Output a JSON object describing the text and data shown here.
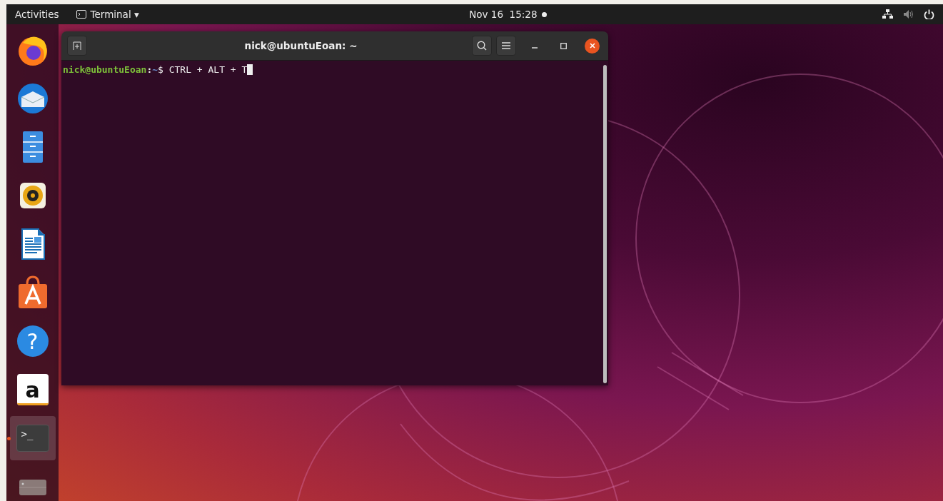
{
  "top_bar": {
    "activities": "Activities",
    "app_menu": {
      "label": "Terminal",
      "caret": "▾"
    },
    "clock": "Nov 16  15:28",
    "notification": true,
    "status_icons": [
      {
        "kind": "network"
      },
      {
        "kind": "volume"
      },
      {
        "kind": "power"
      }
    ]
  },
  "dock": [
    {
      "kind": "firefox",
      "running": false,
      "selected": false
    },
    {
      "kind": "thunderbird",
      "running": false,
      "selected": false
    },
    {
      "kind": "files",
      "running": false,
      "selected": false
    },
    {
      "kind": "rhythmbox",
      "running": false,
      "selected": false
    },
    {
      "kind": "writer",
      "running": false,
      "selected": false
    },
    {
      "kind": "software",
      "running": false,
      "selected": false
    },
    {
      "kind": "help",
      "glyph": "?",
      "running": false,
      "selected": false
    },
    {
      "kind": "amazon",
      "glyph": "a",
      "running": false,
      "selected": false
    },
    {
      "kind": "terminal",
      "glyph": ">_",
      "running": true,
      "selected": true
    },
    {
      "kind": "drive",
      "running": false,
      "selected": false
    }
  ],
  "terminal_window": {
    "title": "nick@ubuntuEoan: ~",
    "lines": [
      {
        "user": "nick@ubuntuEoan",
        "separator": ":",
        "path": "~",
        "symbol": "$",
        "command": "CTRL + ALT + T",
        "cursor": true
      }
    ]
  }
}
